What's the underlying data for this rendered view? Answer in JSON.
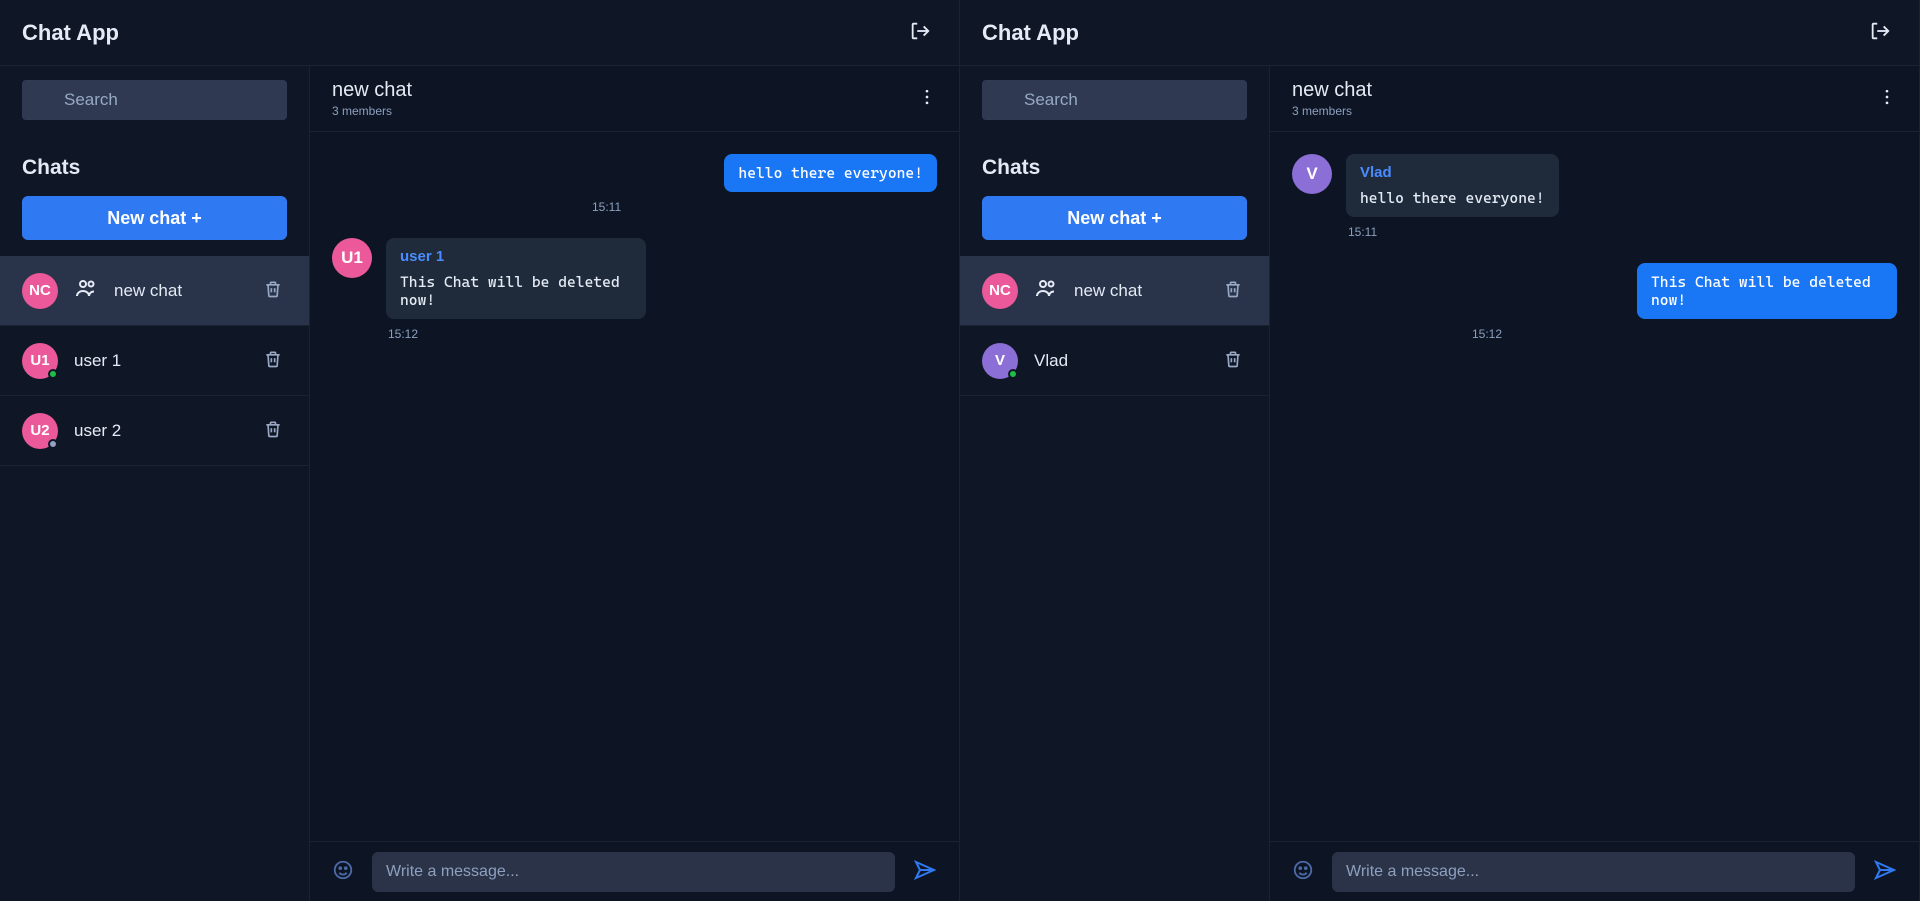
{
  "app_title": "Chat App",
  "search_placeholder": "Search",
  "chats_label": "Chats",
  "newchat_label": "New chat +",
  "left": {
    "sidebar": {
      "items": [
        {
          "initials": "NC",
          "name": "new chat",
          "type": "group",
          "active": true,
          "color": "pink"
        },
        {
          "initials": "U1",
          "name": "user 1",
          "type": "user",
          "status": "online",
          "color": "pink"
        },
        {
          "initials": "U2",
          "name": "user 2",
          "type": "user",
          "status": "offline",
          "color": "pink"
        }
      ]
    },
    "chat": {
      "title": "new chat",
      "subtitle": "3 members",
      "messages": [
        {
          "side": "right",
          "author": "",
          "text": "hello there everyone!",
          "time": "15:11",
          "bubble": "blue",
          "avatar": null
        },
        {
          "side": "left",
          "author": "user 1",
          "text": "This Chat will be deleted now!",
          "time": "15:12",
          "bubble": "dark",
          "avatar": {
            "initials": "U1",
            "color": "pink"
          }
        }
      ],
      "input_placeholder": "Write a message..."
    }
  },
  "right": {
    "sidebar": {
      "items": [
        {
          "initials": "NC",
          "name": "new chat",
          "type": "group",
          "active": true,
          "color": "pink"
        },
        {
          "initials": "V",
          "name": "Vlad",
          "type": "user",
          "status": "online",
          "color": "purple"
        }
      ]
    },
    "chat": {
      "title": "new chat",
      "subtitle": "3 members",
      "messages": [
        {
          "side": "left",
          "author": "Vlad",
          "text": "hello there everyone!",
          "time": "15:11",
          "bubble": "dark",
          "avatar": {
            "initials": "V",
            "color": "purple"
          }
        },
        {
          "side": "right",
          "author": "",
          "text": "This Chat will be deleted now!",
          "time": "15:12",
          "bubble": "blue",
          "avatar": null
        }
      ],
      "input_placeholder": "Write a message..."
    }
  }
}
